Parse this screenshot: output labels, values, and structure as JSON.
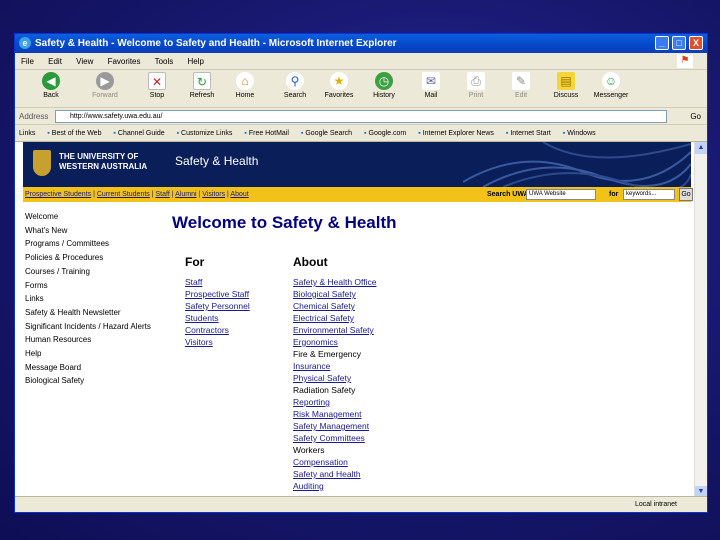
{
  "window": {
    "title": "Safety & Health - Welcome to Safety and Health - Microsoft Internet Explorer",
    "controls": [
      "_",
      "□",
      "X"
    ]
  },
  "menu": [
    "File",
    "Edit",
    "View",
    "Favorites",
    "Tools",
    "Help"
  ],
  "toolbar": {
    "back": "Back",
    "forward": "Forward",
    "stop": "Stop",
    "refresh": "Refresh",
    "home": "Home",
    "search": "Search",
    "favorites": "Favorites",
    "history": "History",
    "mail": "Mail",
    "print": "Print",
    "edit": "Edit",
    "discuss": "Discuss",
    "messenger": "Messenger"
  },
  "address": {
    "label": "Address",
    "url": "http://www.safety.uwa.edu.au/",
    "go": "Go"
  },
  "links_bar": {
    "label": "Links",
    "items": [
      "Best of the Web",
      "Channel Guide",
      "Customize Links",
      "Free HotMail",
      "Google Search",
      "Google.com",
      "Internet Explorer News",
      "Internet Start",
      "Windows"
    ]
  },
  "banner": {
    "university": "THE UNIVERSITY OF WESTERN AUSTRALIA",
    "section": "Safety & Health"
  },
  "navbar": {
    "links": [
      "Prospective Students",
      "Current Students",
      "Staff",
      "Alumni",
      "Visitors",
      "About"
    ],
    "search_label": "Search UWA",
    "scope": "UWA Website",
    "for_label": "for",
    "keywords": "keywords...",
    "go": "Go"
  },
  "sidebar": [
    "Welcome",
    "What's New",
    "Programs / Committees",
    "Policies & Procedures",
    "Courses / Training",
    "Forms",
    "Links",
    "Safety & Health Newsletter",
    "Significant Incidents / Hazard Alerts",
    "Human Resources",
    "Help",
    "Message Board",
    "Biological Safety"
  ],
  "page": {
    "title": "Welcome to Safety & Health",
    "for_heading": "For",
    "about_heading": "About",
    "for_items": [
      "Staff",
      "Prospective Staff",
      "Safety Personnel",
      "Students",
      "Contractors",
      "Visitors"
    ],
    "about_items": [
      {
        "text": "Safety & Health Office",
        "link": true
      },
      {
        "text": "Biological Safety",
        "link": true
      },
      {
        "text": "Chemical Safety",
        "link": true
      },
      {
        "text": "Electrical Safety",
        "link": true
      },
      {
        "text": "Environmental Safety",
        "link": true
      },
      {
        "text": "Ergonomics",
        "link": true
      },
      {
        "text": "Fire & Emergency",
        "link": false
      },
      {
        "text": "Insurance",
        "link": true
      },
      {
        "text": "Physical Safety",
        "link": true
      },
      {
        "text": "Radiation Safety",
        "link": false
      },
      {
        "text": "Reporting",
        "link": true
      },
      {
        "text": "Risk Management",
        "link": true
      },
      {
        "text": "Safety Management",
        "link": true
      },
      {
        "text": "Safety Committees",
        "link": true
      },
      {
        "text": "Workers",
        "link": false
      },
      {
        "text": "Compensation",
        "link": true
      },
      {
        "text": "Safety and Health",
        "link": true
      },
      {
        "text": "Auditing",
        "link": true
      }
    ]
  },
  "status": {
    "zone": "Local intranet"
  },
  "colors": {
    "title_blue": "#0846c8",
    "banner_navy": "#0a1e5a",
    "nav_yellow": "#f2c21a",
    "heading": "#000080"
  }
}
